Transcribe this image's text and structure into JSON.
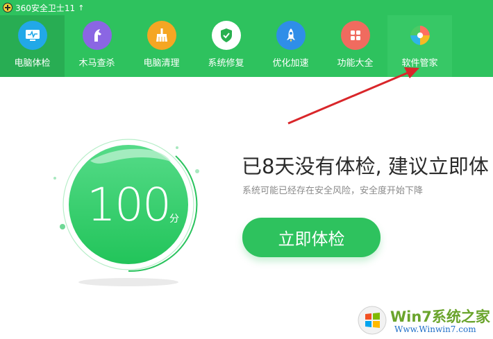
{
  "window": {
    "title": "360安全卫士11"
  },
  "toolbar": {
    "items": [
      {
        "label": "电脑体检",
        "icon": "monitor-icon",
        "color": "#22a8e8"
      },
      {
        "label": "木马查杀",
        "icon": "horse-icon",
        "color": "#8b66e3"
      },
      {
        "label": "电脑清理",
        "icon": "broom-icon",
        "color": "#f5a623"
      },
      {
        "label": "系统修复",
        "icon": "shield-icon",
        "color": "#28b04f"
      },
      {
        "label": "优化加速",
        "icon": "rocket-icon",
        "color": "#2f8ee8"
      },
      {
        "label": "功能大全",
        "icon": "grid-icon",
        "color": "#f06b5f"
      },
      {
        "label": "软件管家",
        "icon": "flower-icon",
        "color": "#ffffff"
      }
    ]
  },
  "score": {
    "value": "100",
    "unit": "分"
  },
  "main": {
    "headline": "已8天没有体检, 建议立即体",
    "subtext": "系统可能已经存在安全风险，安全度开始下降",
    "check_button": "立即体检"
  },
  "watermark": {
    "title": "Win7系统之家",
    "url": "Www.Winwin7.com"
  },
  "colors": {
    "brand_green": "#2ec25e",
    "arrow_red": "#d9262a"
  }
}
